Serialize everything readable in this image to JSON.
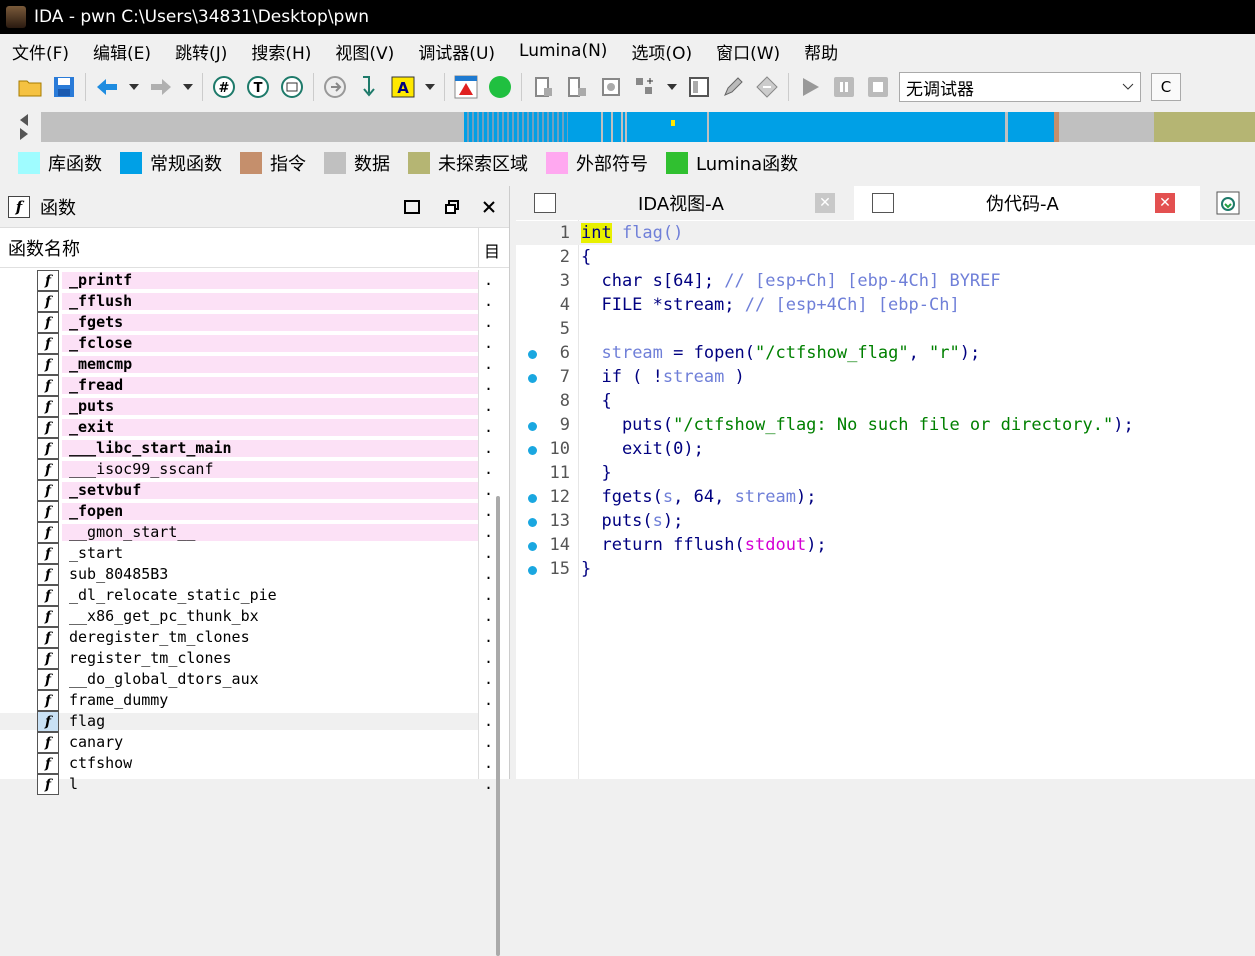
{
  "window": {
    "title": "IDA - pwn C:\\Users\\34831\\Desktop\\pwn"
  },
  "menu": [
    "文件(F)",
    "编辑(E)",
    "跳转(J)",
    "搜索(H)",
    "视图(V)",
    "调试器(U)",
    "Lumina(N)",
    "选项(O)",
    "窗口(W)",
    "帮助"
  ],
  "toolbar": {
    "debugger_select": "无调试器",
    "text_button": "C"
  },
  "legend": [
    {
      "label": "库函数",
      "color": "#9ffcff"
    },
    {
      "label": "常规函数",
      "color": "#00a0e6"
    },
    {
      "label": "指令",
      "color": "#c58f6c"
    },
    {
      "label": "数据",
      "color": "#c0c0c0"
    },
    {
      "label": "未探索区域",
      "color": "#b5b573"
    },
    {
      "label": "外部符号",
      "color": "#ffa8f0"
    },
    {
      "label": "Lumina函数",
      "color": "#30c030"
    }
  ],
  "functions_panel": {
    "title": "函数",
    "column_header": "函数名称",
    "column_header_right": "目",
    "items": [
      {
        "name": "_printf",
        "ext": true
      },
      {
        "name": "_fflush",
        "ext": true
      },
      {
        "name": "_fgets",
        "ext": true
      },
      {
        "name": "_fclose",
        "ext": true
      },
      {
        "name": "_memcmp",
        "ext": true
      },
      {
        "name": "_fread",
        "ext": true
      },
      {
        "name": "_puts",
        "ext": true
      },
      {
        "name": "_exit",
        "ext": true
      },
      {
        "name": "___libc_start_main",
        "ext": true
      },
      {
        "name": "___isoc99_sscanf",
        "ext": true,
        "normal": true
      },
      {
        "name": "_setvbuf",
        "ext": true
      },
      {
        "name": "_fopen",
        "ext": true
      },
      {
        "name": "__gmon_start__",
        "ext": true,
        "normal": true
      },
      {
        "name": "_start"
      },
      {
        "name": "sub_80485B3"
      },
      {
        "name": "_dl_relocate_static_pie"
      },
      {
        "name": "__x86_get_pc_thunk_bx"
      },
      {
        "name": "deregister_tm_clones"
      },
      {
        "name": "register_tm_clones"
      },
      {
        "name": "__do_global_dtors_aux"
      },
      {
        "name": "frame_dummy"
      },
      {
        "name": "flag",
        "selected": true
      },
      {
        "name": "canary"
      },
      {
        "name": "ctfshow"
      },
      {
        "name": "l"
      }
    ],
    "row_suffix": "."
  },
  "tabs": [
    {
      "label": "IDA视图-A"
    },
    {
      "label": "伪代码-A"
    }
  ],
  "code": [
    {
      "n": "1",
      "dot": false
    },
    {
      "n": "2",
      "dot": false,
      "text": "{"
    },
    {
      "n": "3",
      "dot": false
    },
    {
      "n": "4",
      "dot": false
    },
    {
      "n": "5",
      "dot": false,
      "text": ""
    },
    {
      "n": "6",
      "dot": true
    },
    {
      "n": "7",
      "dot": true
    },
    {
      "n": "8",
      "dot": false,
      "text": "  {"
    },
    {
      "n": "9",
      "dot": true
    },
    {
      "n": "10",
      "dot": true
    },
    {
      "n": "11",
      "dot": false,
      "text": "  }"
    },
    {
      "n": "12",
      "dot": true
    },
    {
      "n": "13",
      "dot": true
    },
    {
      "n": "14",
      "dot": true
    },
    {
      "n": "15",
      "dot": true,
      "text": "}"
    }
  ],
  "tokens": {
    "l1_kw": "int",
    "l1_fn": " flag",
    "l1_paren": "()",
    "l3_a": "  char s[64]; ",
    "l3_c": "// [esp+Ch] [ebp-4Ch] BYREF",
    "l4_a": "  FILE *stream; ",
    "l4_c": "// [esp+4Ch] [ebp-Ch]",
    "l6_a": "  ",
    "l6_v": "stream",
    "l6_b": " = fopen(",
    "l6_s1": "\"/ctfshow_flag\"",
    "l6_c": ", ",
    "l6_s2": "\"r\"",
    "l6_d": ");",
    "l7_a": "  if ( !",
    "l7_v": "stream",
    "l7_b": " )",
    "l9_a": "    puts(",
    "l9_s": "\"/ctfshow_flag: No such file or directory.\"",
    "l9_b": ");",
    "l10": "    exit(0);",
    "l12_a": "  fgets(",
    "l12_v1": "s",
    "l12_b": ", 64, ",
    "l12_v2": "stream",
    "l12_c": ");",
    "l13_a": "  puts(",
    "l13_v": "s",
    "l13_b": ");",
    "l14_a": "  return fflush(",
    "l14_g": "stdout",
    "l14_b": ");"
  }
}
